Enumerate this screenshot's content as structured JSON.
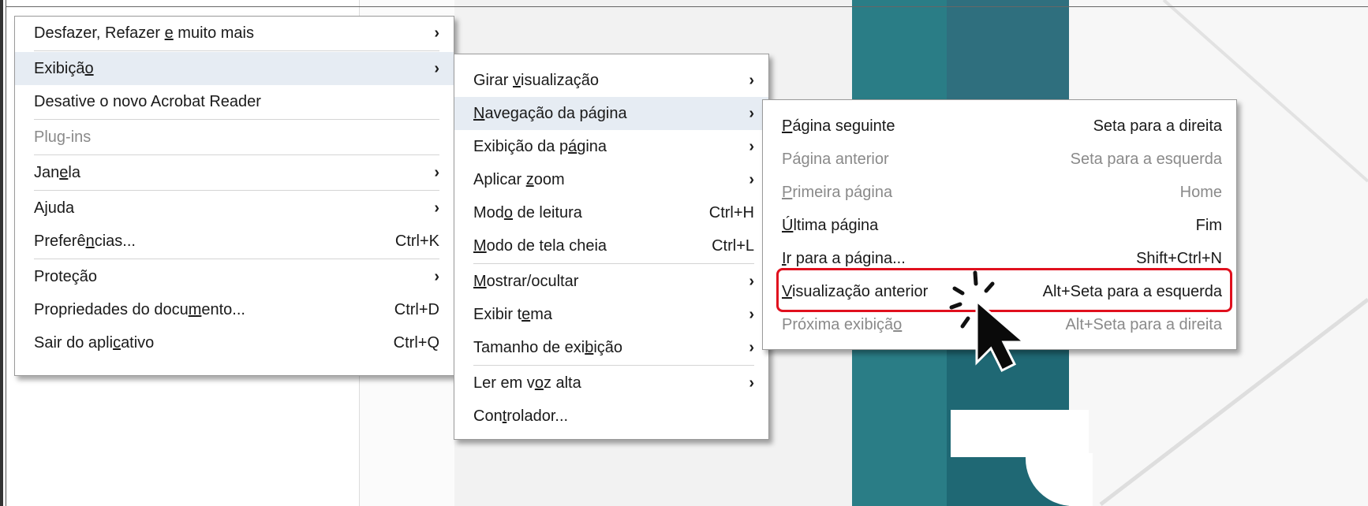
{
  "menu1": {
    "items": [
      {
        "label": "Desfazer, Refazer e muito mais",
        "chevron": "›"
      },
      {
        "label": "Exibição",
        "chevron": "›"
      },
      {
        "label": "Desative o novo Acrobat Reader"
      },
      {
        "label": "Plug-ins"
      },
      {
        "label": "Janela",
        "chevron": "›"
      },
      {
        "label": "Ajuda",
        "chevron": "›"
      },
      {
        "label": "Preferências...",
        "shortcut": "Ctrl+K"
      },
      {
        "label": "Proteção",
        "chevron": "›"
      },
      {
        "label": "Propriedades do documento...",
        "shortcut": "Ctrl+D"
      },
      {
        "label": "Sair do aplicativo",
        "shortcut": "Ctrl+Q"
      }
    ]
  },
  "menu2": {
    "items": [
      {
        "label": "Girar visualização",
        "chevron": "›"
      },
      {
        "label": "Navegação da página",
        "chevron": "›"
      },
      {
        "label": "Exibição da página",
        "chevron": "›"
      },
      {
        "label": "Aplicar zoom",
        "chevron": "›"
      },
      {
        "label": "Modo de leitura",
        "shortcut": "Ctrl+H"
      },
      {
        "label": "Modo de tela cheia",
        "shortcut": "Ctrl+L"
      },
      {
        "label": "Mostrar/ocultar",
        "chevron": "›"
      },
      {
        "label": "Exibir tema",
        "chevron": "›"
      },
      {
        "label": "Tamanho de exibição",
        "chevron": "›"
      },
      {
        "label": "Ler em voz alta",
        "chevron": "›"
      },
      {
        "label": "Controlador..."
      }
    ]
  },
  "menu3": {
    "items": [
      {
        "label": "Página seguinte",
        "shortcut": "Seta para a direita"
      },
      {
        "label": "Página anterior",
        "shortcut": "Seta para a esquerda"
      },
      {
        "label": "Primeira página",
        "shortcut": "Home"
      },
      {
        "label": "Última página",
        "shortcut": "Fim"
      },
      {
        "label": "Ir para a página...",
        "shortcut": "Shift+Ctrl+N"
      },
      {
        "label": "Visualização anterior",
        "shortcut": "Alt+Seta para a esquerda"
      },
      {
        "label": "Próxima exibição",
        "shortcut": "Alt+Seta para a direita"
      }
    ]
  },
  "colors": {
    "highlight_box": "#e0101e",
    "menu_highlight": "#e6ecf3"
  },
  "icons": {
    "cursor": "pointer-cursor-icon"
  }
}
